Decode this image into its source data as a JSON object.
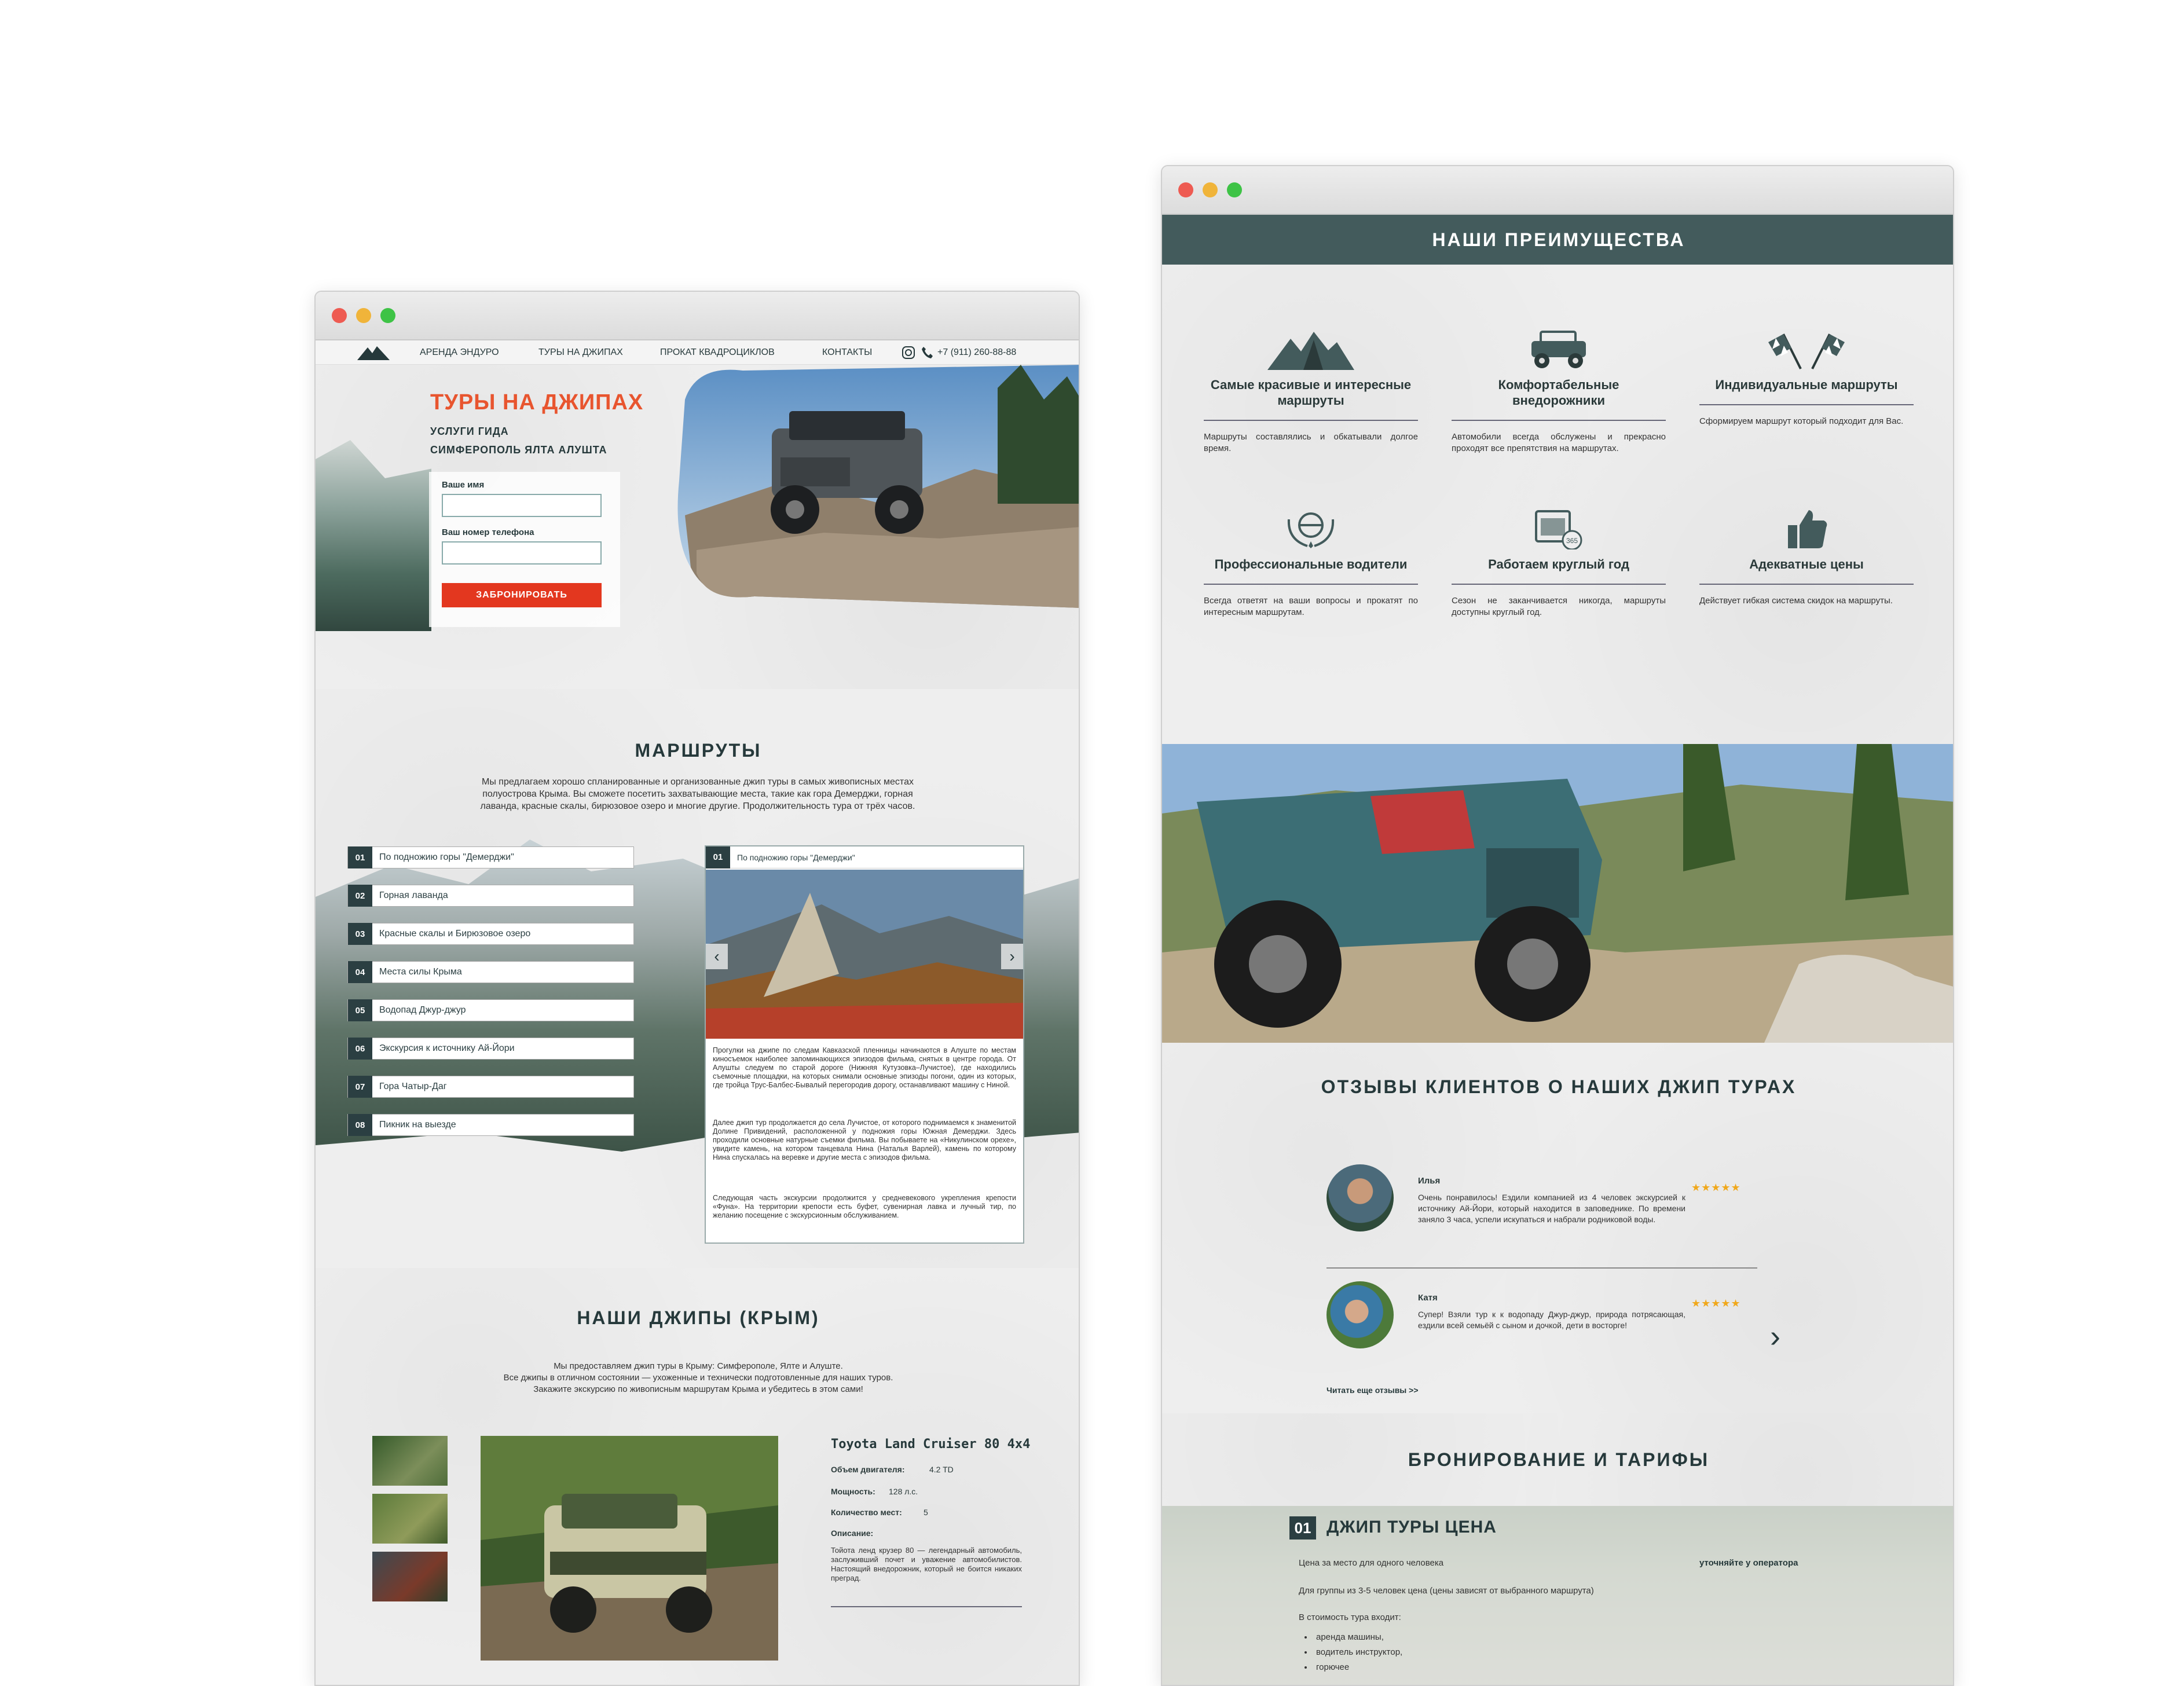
{
  "left_window": {
    "nav": {
      "items": [
        "АРЕНДА ЭНДУРО",
        "ТУРЫ НА ДЖИПАХ",
        "ПРОКАТ КВАДРОЦИКЛОВ",
        "КОНТАКТЫ"
      ],
      "phone": "+7 (911) 260-88-88",
      "logo_icon": "mountain-icon",
      "instagram_icon": "instagram-icon",
      "phone_icon": "phone-icon"
    },
    "hero": {
      "title": "ТУРЫ НА ДЖИПАХ",
      "subtitle1": "УСЛУГИ ГИДА",
      "subtitle2": "СИМФЕРОПОЛЬ ЯЛТА АЛУШТА",
      "name_label": "Ваше имя",
      "phone_label": "Ваш номер телефона",
      "button": "ЗАБРОНИРОВАТЬ"
    },
    "routes": {
      "title": "МАРШРУТЫ",
      "intro": "Мы предлагаем хорошо спланированные и организованные джип туры в самых живописных местах полуострова Крыма. Вы сможете посетить захватывающие места, такие как гора Демерджи, горная лаванда, красные скалы, бирюзовое озеро и многие другие. Продолжительность тура от трёх часов.",
      "items": [
        {
          "num": "01",
          "label": "По подножию горы \"Демерджи\""
        },
        {
          "num": "02",
          "label": "Горная лаванда"
        },
        {
          "num": "03",
          "label": "Красные скалы и Бирюзовое озеро"
        },
        {
          "num": "04",
          "label": "Места силы Крыма"
        },
        {
          "num": "05",
          "label": "Водопад Джур-джур"
        },
        {
          "num": "06",
          "label": "Экскурсия к источнику Ай-Йори"
        },
        {
          "num": "07",
          "label": "Гора Чатыр-Даг"
        },
        {
          "num": "08",
          "label": "Пикник на выезде"
        }
      ],
      "detail": {
        "num": "01",
        "title": "По подножию горы \"Демерджи\"",
        "p1": "Прогулки на джипе по следам Кавказской пленницы начинаются в Алуште по местам киносъемок наиболее запоминающихся эпизодов фильма, снятых в центре города. От Алушты следуем по старой дороге (Нижняя Кутузовка–Лучистое), где находились съемочные площадки, на которых снимали основные эпизоды погони, один из которых, где тройца Трус-Балбес-Бывалый перегородив дорогу, останавливают машину с Ниной.",
        "p2": "Далее джип тур продолжается до села Лучистое, от которого поднимаемся к знаменитой Долине Привидений, расположенной у подножия горы Южная Демерджи. Здесь проходили основные натурные съемки фильма. Вы побываете на «Никулинском орехе», увидите камень, на котором танцевала Нина (Наталья Варлей), камень по которому Нина спускалась на веревке и другие места с эпизодов фильма.",
        "p3": "Следующая часть экскурсии продолжится у средневекового укрепления крепости «Фуна». На территории крепости есть буфет, сувенирная лавка и лучный тир, по желанию посещение с экскурсионным обслуживанием."
      }
    },
    "jeeps": {
      "title": "НАШИ ДЖИПЫ (КРЫМ)",
      "intro1": "Мы предоставляем джип туры в Крыму: Симферополе, Ялте и Алуште.",
      "intro2": "Все джипы в отличном состоянии — ухоженные и технически подготовленные для наших туров.",
      "intro3": "Закажите экскурсию по живописным маршрутам Крыма и убедитесь в этом сами!",
      "car": {
        "name": "Toyota Land Cruiser 80 4x4",
        "engine_label": "Объем двигателя:",
        "engine": "4.2 TD",
        "power_label": "Мощность:",
        "power": "128 л.с.",
        "seats_label": "Количество мест:",
        "seats": "5",
        "desc_label": "Описание:",
        "desc": "Тойота ленд крузер 80 — легендарный автомобиль, заслуживший почет и уважение автомобилистов. Настоящий внедорожник, который не боится никаких преград."
      }
    }
  },
  "right_window": {
    "advantages": {
      "title": "НАШИ ПРЕИМУЩЕСТВА",
      "items": [
        {
          "icon": "mountains-icon",
          "title": "Самые красивые и интересные маршруты",
          "desc": "Маршруты составлялись и обкатывали долгое время."
        },
        {
          "icon": "jeep-icon",
          "title": "Комфортабельные внедорожники",
          "desc": "Автомобили всегда обслужены и прекрасно проходят все препятствия на маршрутах."
        },
        {
          "icon": "checkered-flags-icon",
          "title": "Индивидуальные маршруты",
          "desc": "Сформируем маршрут который подходит для Вас."
        },
        {
          "icon": "driver-badge-icon",
          "title": "Профессиональные водители",
          "desc": "Всегда ответят на ваши вопросы и прокатят по интересным маршрутам."
        },
        {
          "icon": "calendar-365-icon",
          "title": "Работаем круглый год",
          "desc": "Сезон не заканчивается никогда, маршруты доступны круглый год."
        },
        {
          "icon": "thumbs-up-icon",
          "title": "Адекватные цены",
          "desc": "Действует гибкая система скидок на маршруты."
        }
      ]
    },
    "reviews": {
      "title": "ОТЗЫВЫ КЛИЕНТОВ О НАШИХ ДЖИП ТУРАХ",
      "items": [
        {
          "name": "Илья",
          "text": "Очень понравилось! Ездили компанией из 4 человек экскурсией к источнику Ай-Йори, который находится в заповеднике. По времени заняло 3 часа, успели искупаться и набрали родниковой воды.",
          "stars": "★★★★★"
        },
        {
          "name": "Катя",
          "text": "Супер! Взяли тур к к водопаду Джур-джур, природа потрясающая, ездили всей семьёй с сыном и дочкой, дети в восторге!",
          "stars": "★★★★★"
        }
      ],
      "more": "Читать еще отзывы >>"
    },
    "booking": {
      "title": "БРОНИРОВАНИЕ И ТАРИФЫ",
      "num": "01",
      "subtitle": "ДЖИП ТУРЫ ЦЕНА",
      "line1": "Цена за место для одного человека",
      "line2": "Для группы из 3-5 человек цена (цены зависят от выбранного маршрута)",
      "line3": "В стоимость тура входит:",
      "bullets": [
        "аренда машины,",
        "водитель инструктор,",
        "горючее"
      ],
      "operator": "уточняйте у оператора"
    }
  }
}
